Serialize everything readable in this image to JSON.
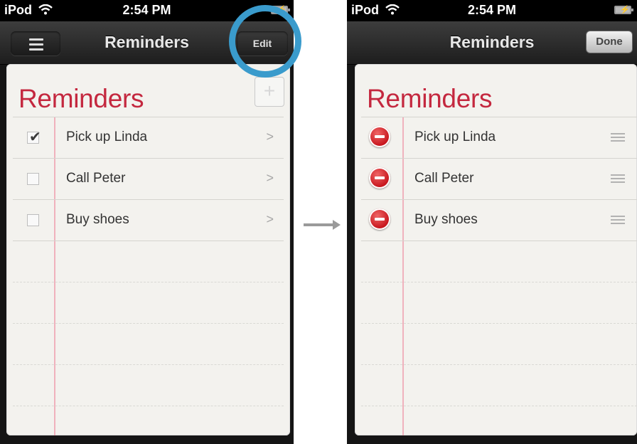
{
  "status": {
    "carrier": "iPod",
    "time": "2:54 PM"
  },
  "nav": {
    "title": "Reminders",
    "edit_label": "Edit",
    "done_label": "Done"
  },
  "list": {
    "title": "Reminders",
    "add_symbol": "+",
    "items": [
      {
        "label": "Pick up Linda",
        "checked": true
      },
      {
        "label": "Call Peter",
        "checked": false
      },
      {
        "label": "Buy shoes",
        "checked": false
      }
    ]
  },
  "colors": {
    "title_red": "#c4283f",
    "highlight_blue": "#3a9bcc",
    "delete_red": "#c7151d"
  }
}
